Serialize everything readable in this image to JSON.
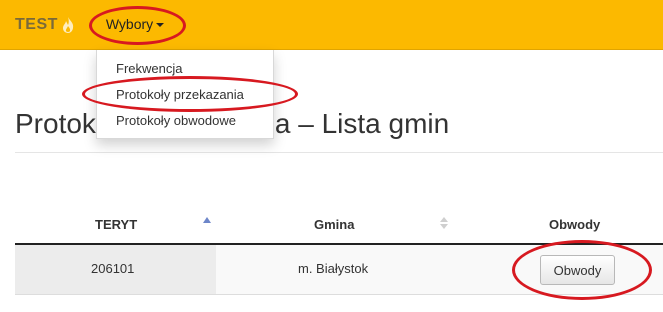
{
  "navbar": {
    "brand": "TEST",
    "menu_label": "Wybory",
    "dropdown_items": [
      "Frekwencja",
      "Protokoły przekazania",
      "Protokoły obwodowe"
    ]
  },
  "page": {
    "title": "Protokoły przekazania – Lista gmin"
  },
  "table": {
    "headers": [
      "TERYT",
      "Gmina",
      "Obwody"
    ],
    "rows": [
      {
        "teryt": "206101",
        "gmina": "m. Białystok",
        "action": "Obwody"
      }
    ]
  },
  "colors": {
    "navbar": "#fcb900",
    "annotation": "#d71920"
  }
}
